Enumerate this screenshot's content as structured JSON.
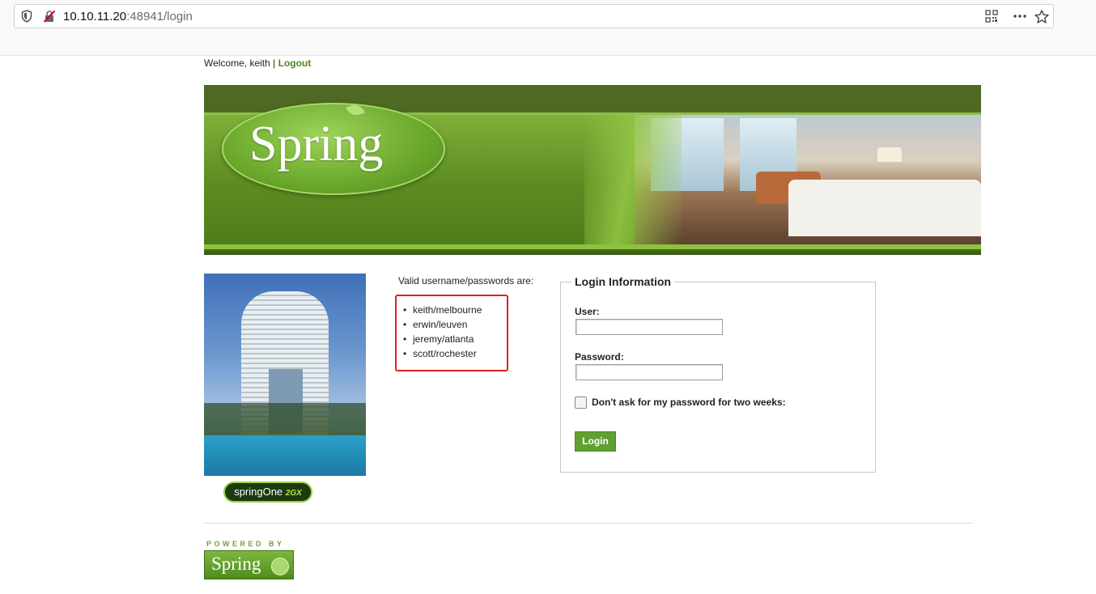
{
  "browser": {
    "url_host": "10.10.11.20",
    "url_rest": ":48941/login",
    "icons": [
      "shield-icon",
      "insecure-lock-icon",
      "qr-code-icon",
      "more-icon",
      "bookmark-star-icon"
    ]
  },
  "header": {
    "welcome_text": "Welcome, keith |",
    "logout_label": "Logout"
  },
  "banner": {
    "logo_text": "Spring"
  },
  "sidebar": {
    "springone_label": "springOne",
    "springone_year": "2GX"
  },
  "credentials": {
    "title": "Valid username/passwords are:",
    "items": [
      "keith/melbourne",
      "erwin/leuven",
      "jeremy/atlanta",
      "scott/rochester"
    ]
  },
  "login": {
    "legend": "Login Information",
    "user_label": "User:",
    "user_value": "",
    "password_label": "Password:",
    "password_value": "",
    "remember_label": "Don't ask for my password for two weeks:",
    "remember_checked": false,
    "submit_label": "Login"
  },
  "footer": {
    "powered_by": "POWERED BY",
    "logo_text": "Spring"
  },
  "colors": {
    "brand_green": "#60a032",
    "link_green": "#4e8a1e",
    "highlight_red": "#e02020"
  }
}
